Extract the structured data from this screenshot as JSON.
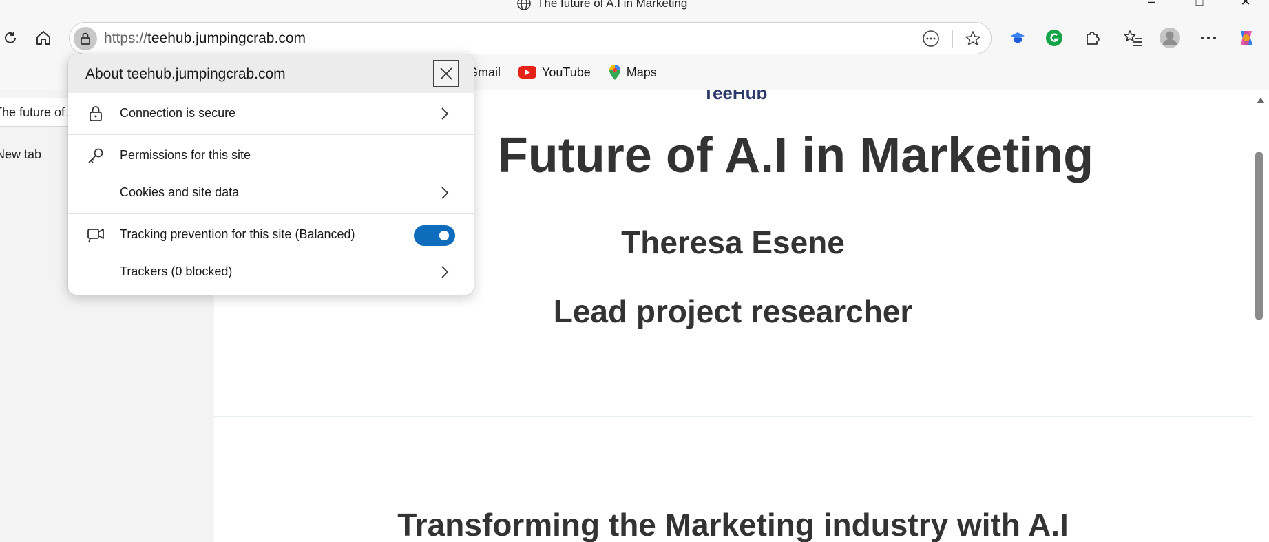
{
  "window": {
    "title": "The future of A.I in Marketing"
  },
  "toolbar": {
    "url_scheme": "https://",
    "url_host": "teehub.jumpingcrab.com"
  },
  "favorites": [
    {
      "label": "Gmail",
      "icon": "gmail-icon"
    },
    {
      "label": "YouTube",
      "icon": "youtube-icon"
    },
    {
      "label": "Maps",
      "icon": "maps-icon"
    }
  ],
  "sidebar": {
    "active_tab": "The future of A.I in Marketing",
    "new_tab": "New tab"
  },
  "site_info": {
    "title": "About teehub.jumpingcrab.com",
    "connection": "Connection is secure",
    "permissions": "Permissions for this site",
    "cookies": "Cookies and site data",
    "tracking": "Tracking prevention for this site (Balanced)",
    "tracking_enabled": true,
    "trackers": "Trackers (0 blocked)"
  },
  "page": {
    "logo": "TeeHub",
    "heading": "Future of A.I in Marketing",
    "author": "Theresa Esene",
    "role": "Lead project researcher",
    "section_heading": "Transforming the Marketing industry with A.I"
  },
  "colors": {
    "accent": "#0f6cbd",
    "heading": "#333333",
    "logo": "#2b3a6b"
  }
}
